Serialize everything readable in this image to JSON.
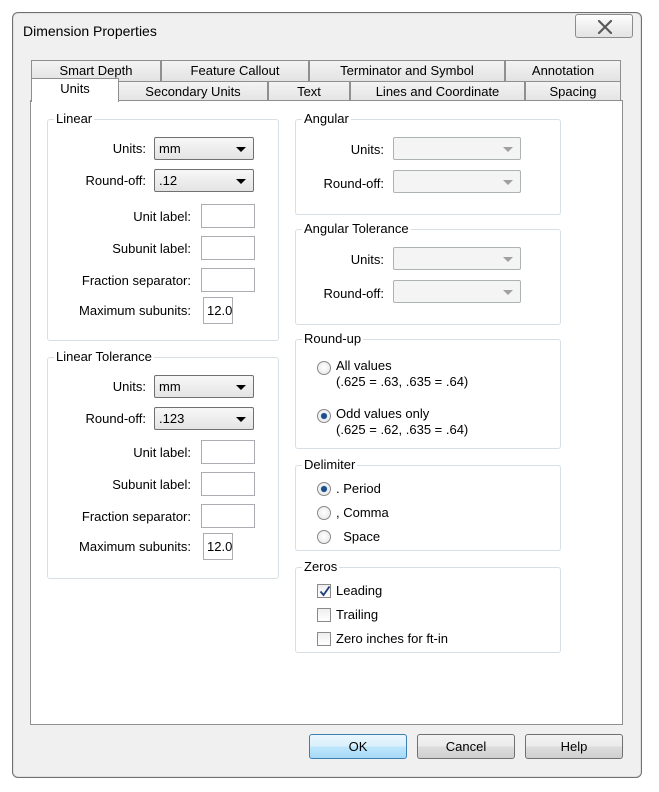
{
  "window": {
    "title": "Dimension Properties"
  },
  "tabs_back": [
    "Smart Depth",
    "Feature Callout",
    "Terminator and Symbol",
    "Annotation"
  ],
  "tabs_front": [
    "Units",
    "Secondary Units",
    "Text",
    "Lines and Coordinate",
    "Spacing"
  ],
  "linear": {
    "title": "Linear",
    "units_label": "Units:",
    "units_value": "mm",
    "roundoff_label": "Round-off:",
    "roundoff_value": ".12",
    "unit_label": "Unit label:",
    "subunit_label": "Subunit label:",
    "fraction_separator": "Fraction separator:",
    "max_subunits_label": "Maximum subunits:",
    "max_subunits_value": "12.0"
  },
  "linear_tolerance": {
    "title": "Linear Tolerance",
    "units_label": "Units:",
    "units_value": "mm",
    "roundoff_label": "Round-off:",
    "roundoff_value": ".123",
    "unit_label": "Unit label:",
    "subunit_label": "Subunit label:",
    "fraction_separator": "Fraction separator:",
    "max_subunits_label": "Maximum subunits:",
    "max_subunits_value": "12.0"
  },
  "angular": {
    "title": "Angular",
    "units_label": "Units:",
    "roundoff_label": "Round-off:"
  },
  "angular_tolerance": {
    "title": "Angular Tolerance",
    "units_label": "Units:",
    "roundoff_label": "Round-off:"
  },
  "roundup": {
    "title": "Round-up",
    "all_values": "All values",
    "all_values_example": "(.625 = .63, .635 = .64)",
    "odd_values": "Odd values only",
    "odd_values_example": "(.625 = .62, .635 = .64)",
    "selected": "odd"
  },
  "delimiter": {
    "title": "Delimiter",
    "period": ". Period",
    "comma": ", Comma",
    "space": "  Space",
    "selected": "period"
  },
  "zeros": {
    "title": "Zeros",
    "leading": "Leading",
    "leading_checked": true,
    "trailing": "Trailing",
    "trailing_checked": false,
    "zero_inches": "Zero inches for ft-in",
    "zero_inches_checked": false
  },
  "buttons": {
    "ok": "OK",
    "cancel": "Cancel",
    "help": "Help"
  },
  "colors": {
    "radio_dot": "#1c4e8c",
    "default_button_border": "#3c7fb1"
  },
  "icons": {
    "close": "close-icon",
    "check": "checkmark-icon"
  }
}
